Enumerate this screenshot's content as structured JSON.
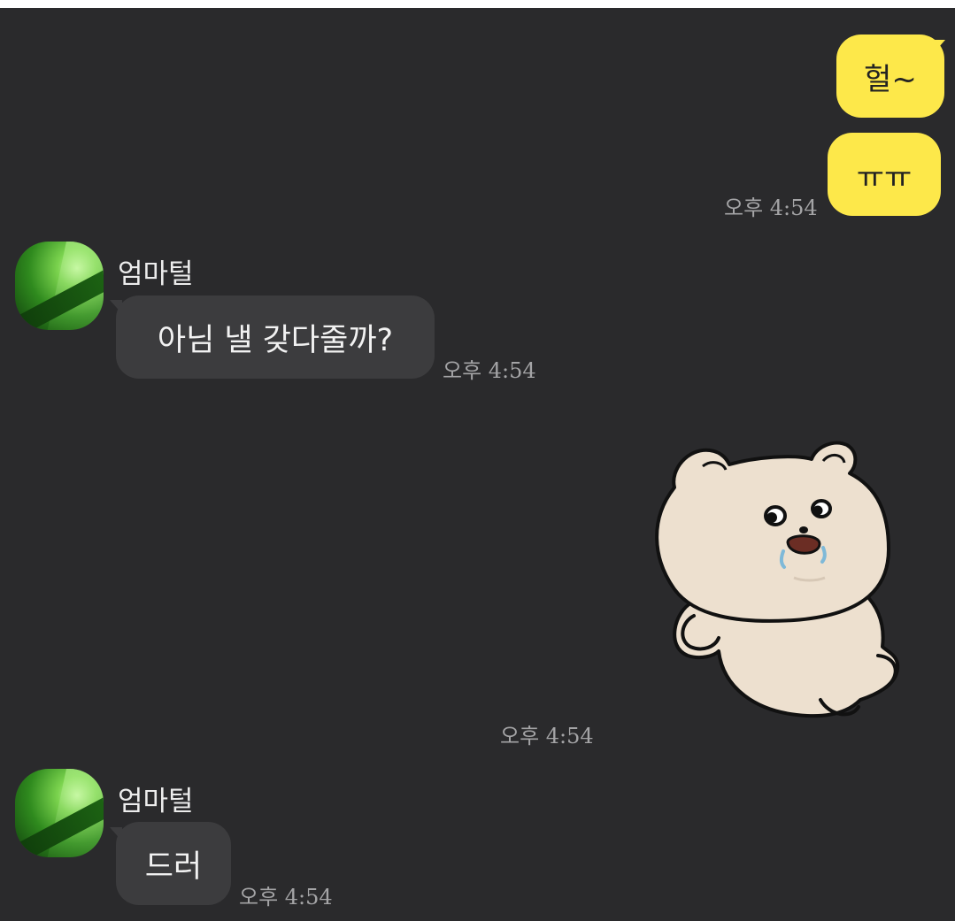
{
  "messages": [
    {
      "sender": "me",
      "text": "헐~"
    },
    {
      "sender": "me",
      "text": "ㅠㅠ",
      "time": "오후 4:54"
    },
    {
      "sender": "엄마털",
      "text": "아님 낼 갖다줄까?",
      "time": "오후 4:54"
    },
    {
      "sender": "me",
      "sticker": "crying-bear-sticker",
      "time": "오후 4:54"
    },
    {
      "sender": "엄마털",
      "text": "드러",
      "time": "오후 4:54"
    }
  ],
  "colors": {
    "background": "#2a2a2c",
    "my_bubble": "#fde84a",
    "other_bubble": "#3c3c3e",
    "timestamp": "#a4a4a6"
  }
}
